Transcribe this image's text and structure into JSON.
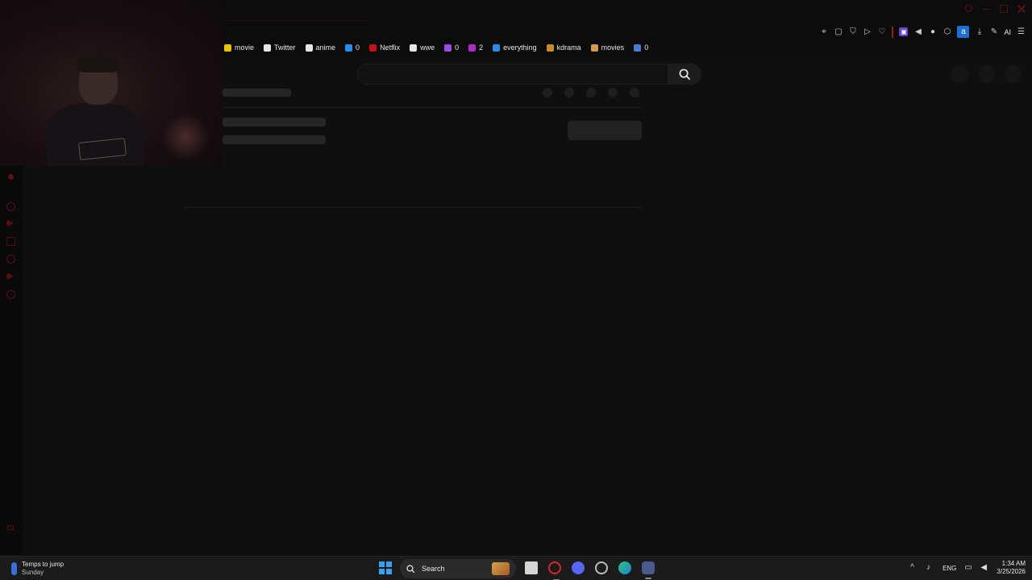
{
  "bookmarks": [
    {
      "label": "movie",
      "icon": "play-icon",
      "color": "#f2c200"
    },
    {
      "label": "Twitter",
      "icon": "x-logo-icon",
      "color": "#e6e6e6"
    },
    {
      "label": "anime",
      "icon": "anime-icon",
      "color": "#e6e6e6"
    },
    {
      "label": "0",
      "icon": "blue-app-icon",
      "color": "#2a8be8"
    },
    {
      "label": "Netflix",
      "icon": "netflix-icon",
      "color": "#c4121a"
    },
    {
      "label": "wwe",
      "icon": "document-icon",
      "color": "#e6e6e6"
    },
    {
      "label": "0",
      "icon": "purple-app-icon",
      "color": "#9b4de0"
    },
    {
      "label": "2",
      "icon": "grape-icon",
      "color": "#b02ac8"
    },
    {
      "label": "everything",
      "icon": "info-icon",
      "color": "#2a8be8"
    },
    {
      "label": "kdrama",
      "icon": "dots-icon",
      "color": "#c88a2a"
    },
    {
      "label": "movies",
      "icon": "burger-icon",
      "color": "#d49a50"
    },
    {
      "label": "0",
      "icon": "folder-icon",
      "color": "#4a7ad0"
    }
  ],
  "toolbar": {
    "ai_label": "AI",
    "amazon_badge": "a"
  },
  "taskbar": {
    "weather_title": "Temps to jump",
    "weather_sub": "Sunday",
    "search_label": "Search",
    "language": "ENG",
    "time": "1:34 AM",
    "date": "3/25/2026"
  },
  "colors": {
    "accent": "#8b0f0f",
    "background": "#0f0f0f",
    "windows_blue": "#3aa0f0"
  }
}
